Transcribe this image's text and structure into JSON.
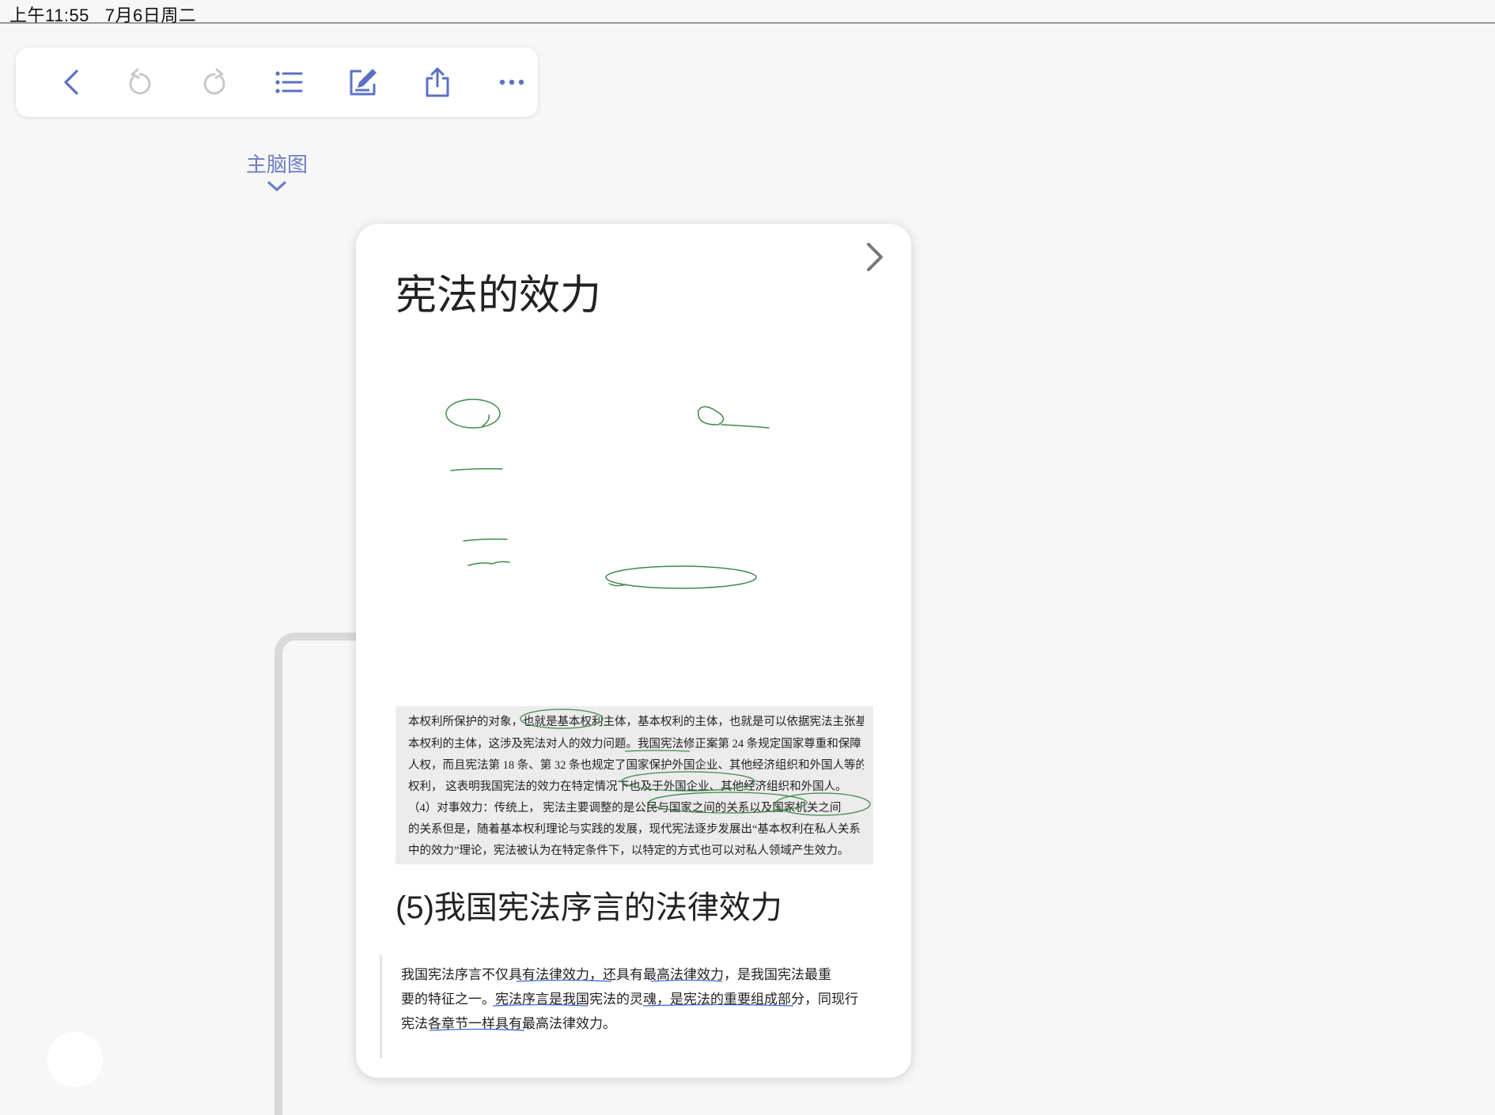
{
  "status_bar": {
    "time": "上午11:55",
    "date": "7月6日周二"
  },
  "toolbar": {
    "buttons": [
      {
        "icon": "back-icon"
      },
      {
        "icon": "undo-icon"
      },
      {
        "icon": "redo-icon"
      },
      {
        "icon": "outline-list-icon"
      },
      {
        "icon": "edit-icon"
      },
      {
        "icon": "share-icon"
      },
      {
        "icon": "more-icon"
      }
    ],
    "accent_color": "#5b72c2"
  },
  "mind_map_link": {
    "label": "主脑图"
  },
  "card": {
    "title": "宪法的效力",
    "scan_excerpt": [
      "本权利所保护的对象，也就是基本权利主体，基本权利的主体，也就是可以依据宪法主张基",
      "本权利的主体，这涉及宪法对人的效力问题。我国宪法修正案第 24 条规定国家尊重和保障",
      "人权，而且宪法第 18 条、第 32 条也规定了国家保护外国企业、其他经济组织和外国人等的",
      "权利，  这表明我国宪法的效力在特定情况下也及于外国企业、其他经济组织和外国人。",
      "    （4）对事效力：传统上，  宪法主要调整的是公民与国家之间的关系以及国家机关之间",
      "的关系但是，随着基本权利理论与实践的发展，现代宪法逐步发展出“基本权利在私人关系",
      "中的效力”理论，宪法被认为在特定条件下，以特定的方式也可以对私人领域产生效力。"
    ],
    "section_title": "(5)我国宪法序言的法律效力",
    "quote_excerpt": [
      "    我国宪法序言不仅具有法律效力，还具有最高法律效力，是我国宪法最重",
      "要的特征之一。宪法序言是我国宪法的灵魂，是宪法的重要组成部分，同现行",
      "宪法各章节一样具有最高法律效力。"
    ],
    "ink_color": "#3f8a4a",
    "underline_color": "#3c6ad6"
  }
}
